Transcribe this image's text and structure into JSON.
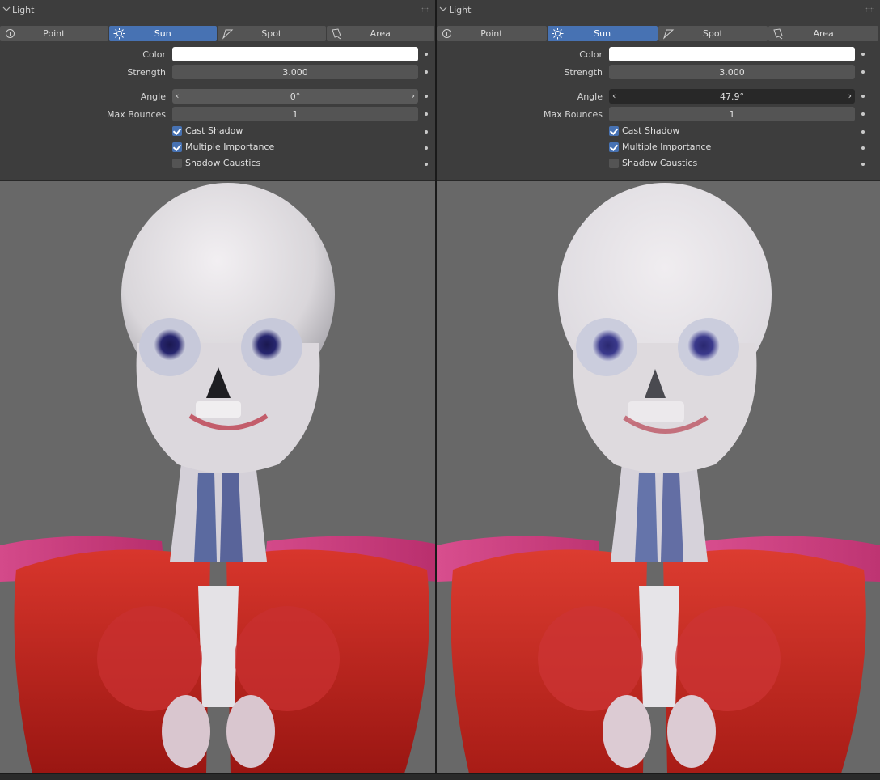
{
  "panels": [
    {
      "header": "Light",
      "light_types": [
        "Point",
        "Sun",
        "Spot",
        "Area"
      ],
      "active_type": "Sun",
      "color_label": "Color",
      "color_value": "#ffffff",
      "strength_label": "Strength",
      "strength_value": "3.000",
      "angle_label": "Angle",
      "angle_value": "0°",
      "max_bounces_label": "Max Bounces",
      "max_bounces_value": "1",
      "checkboxes": [
        {
          "label": "Cast Shadow",
          "checked": true
        },
        {
          "label": "Multiple Importance",
          "checked": true
        },
        {
          "label": "Shadow Caustics",
          "checked": false
        }
      ],
      "viewport_render": "skeleton-muscle-render-hard-shadow"
    },
    {
      "header": "Light",
      "light_types": [
        "Point",
        "Sun",
        "Spot",
        "Area"
      ],
      "active_type": "Sun",
      "color_label": "Color",
      "color_value": "#ffffff",
      "strength_label": "Strength",
      "strength_value": "3.000",
      "angle_label": "Angle",
      "angle_value": "47.9°",
      "max_bounces_label": "Max Bounces",
      "max_bounces_value": "1",
      "checkboxes": [
        {
          "label": "Cast Shadow",
          "checked": true
        },
        {
          "label": "Multiple Importance",
          "checked": true
        },
        {
          "label": "Shadow Caustics",
          "checked": false
        }
      ],
      "viewport_render": "skeleton-muscle-render-soft-shadow"
    }
  ],
  "colors": {
    "active_button": "#4772b3",
    "panel_bg": "#3d3d3d",
    "viewport_bg": "#686868",
    "muscle_red": "#c0201f",
    "shoulder_pink": "#c93a7a",
    "bone_white": "#e6e3e6"
  }
}
